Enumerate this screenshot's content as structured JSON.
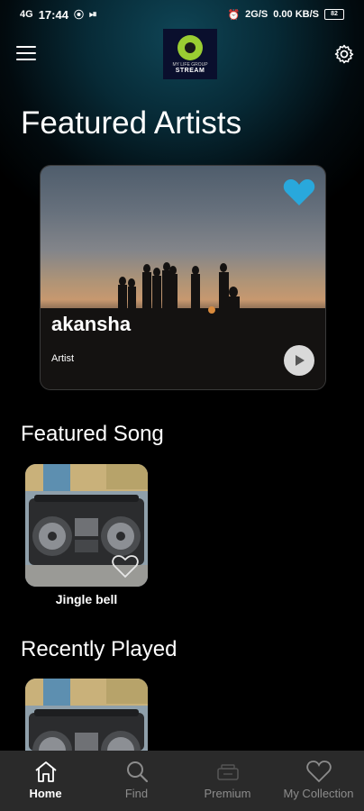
{
  "status_bar": {
    "time": "17:44",
    "signal_text": "4G",
    "battery": "82",
    "network_speed": "0.00 KB/S",
    "network_rate": "2G/S"
  },
  "app": {
    "logo_tag": "MY LIFE GROUP",
    "logo_text": "STREAM"
  },
  "sections": {
    "featured_artists": "Featured Artists",
    "featured_song": "Featured Song",
    "recently_played": "Recently Played"
  },
  "artist": {
    "name": "akansha",
    "role": "Artist"
  },
  "featured_song": {
    "title": "Jingle bell"
  },
  "nav": [
    {
      "label": "Home",
      "icon": "home-icon"
    },
    {
      "label": "Find",
      "icon": "search-icon"
    },
    {
      "label": "Premium",
      "icon": "premium-icon"
    },
    {
      "label": "My Collection",
      "icon": "heart-icon"
    }
  ],
  "colors": {
    "accent": "#29a8dc",
    "background": "#000000",
    "nav_background": "#2a2a2a",
    "nav_inactive": "#8c8c8c"
  }
}
